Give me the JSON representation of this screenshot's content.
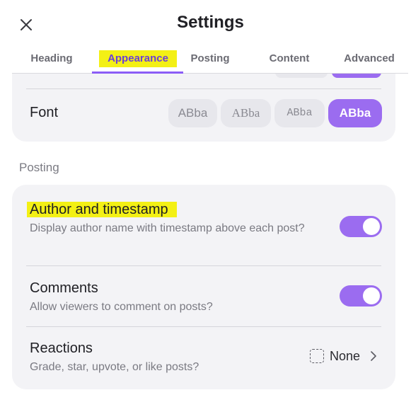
{
  "header": {
    "title": "Settings"
  },
  "tabs": [
    {
      "label": "Heading"
    },
    {
      "label": "Appearance"
    },
    {
      "label": "Posting"
    },
    {
      "label": "Content"
    },
    {
      "label": "Advanced"
    }
  ],
  "appearance": {
    "font_label": "Font",
    "font_options": [
      "ABba",
      "ABba",
      "ABba",
      "ABba"
    ],
    "selected_font_index": 3
  },
  "posting": {
    "section_label": "Posting",
    "author_timestamp": {
      "title": "Author and timestamp",
      "description": "Display author name with timestamp above each post?",
      "enabled": true
    },
    "comments": {
      "title": "Comments",
      "description": "Allow viewers to comment on posts?",
      "enabled": true
    },
    "reactions": {
      "title": "Reactions",
      "description": "Grade, star, upvote, or like posts?",
      "value": "None"
    }
  },
  "colors": {
    "accent": "#9b6cf0",
    "highlight": "#f3f015",
    "card_bg": "#f3f3f6"
  }
}
